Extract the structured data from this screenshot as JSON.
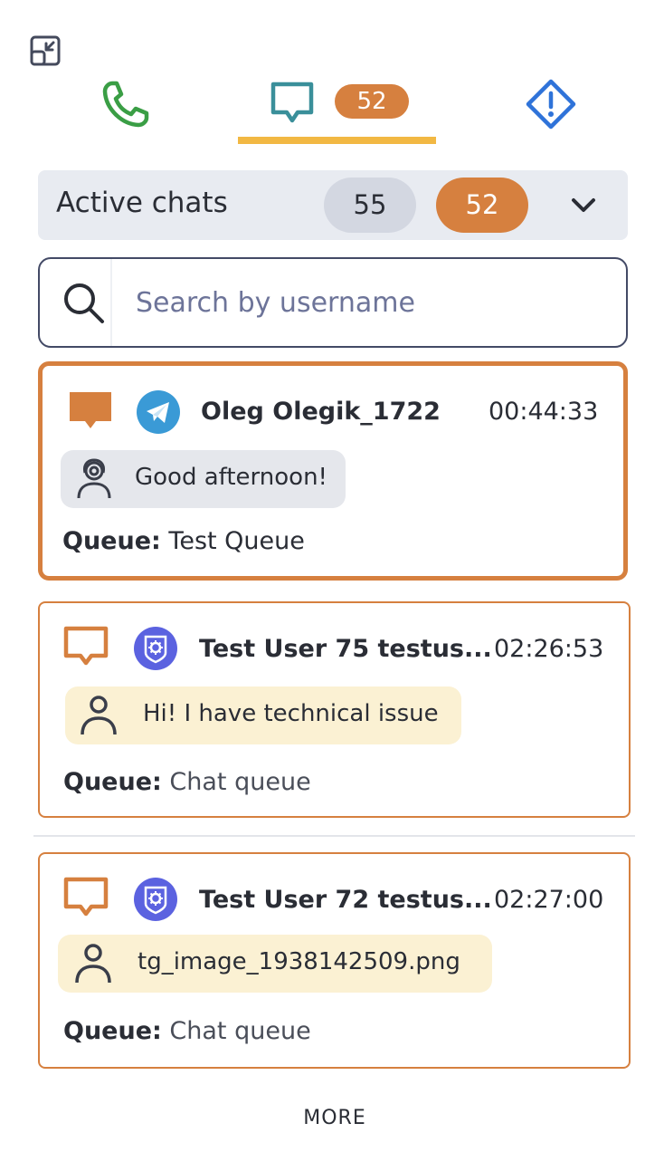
{
  "tabs": {
    "chats_badge": "52"
  },
  "active_chats": {
    "title": "Active chats",
    "total_count": "55",
    "my_count": "52"
  },
  "search": {
    "placeholder": "Search by username"
  },
  "chats": [
    {
      "name": "Oleg Olegik_1722",
      "time": "00:44:33",
      "channel": "telegram",
      "last_message": "Good afternoon!",
      "queue_label": "Queue:",
      "queue_value": "Test Queue"
    },
    {
      "name": "Test User 75 testus...",
      "time": "02:26:53",
      "channel": "bot",
      "last_message": "Hi! I have technical issue",
      "queue_label": "Queue:",
      "queue_value": "Chat queue"
    },
    {
      "name": "Test User 72 testus...",
      "time": "02:27:00",
      "channel": "bot",
      "last_message": "tg_image_1938142509.png",
      "queue_label": "Queue:",
      "queue_value": "Chat queue"
    }
  ],
  "more_label": "MORE",
  "colors": {
    "accent_orange": "#d6803f",
    "tab_underline": "#f2b843",
    "phone_green": "#3a9e45",
    "chat_teal": "#3a8f9a",
    "alert_blue": "#2f73d9",
    "telegram_blue": "#3a9ad6",
    "bot_purple": "#5b62e0"
  },
  "icons": [
    "collapse-icon",
    "phone-icon",
    "chat-icon",
    "alert-diamond-icon",
    "chevron-down-icon",
    "search-icon",
    "telegram-icon",
    "bot-icon",
    "operator-icon",
    "user-icon"
  ]
}
